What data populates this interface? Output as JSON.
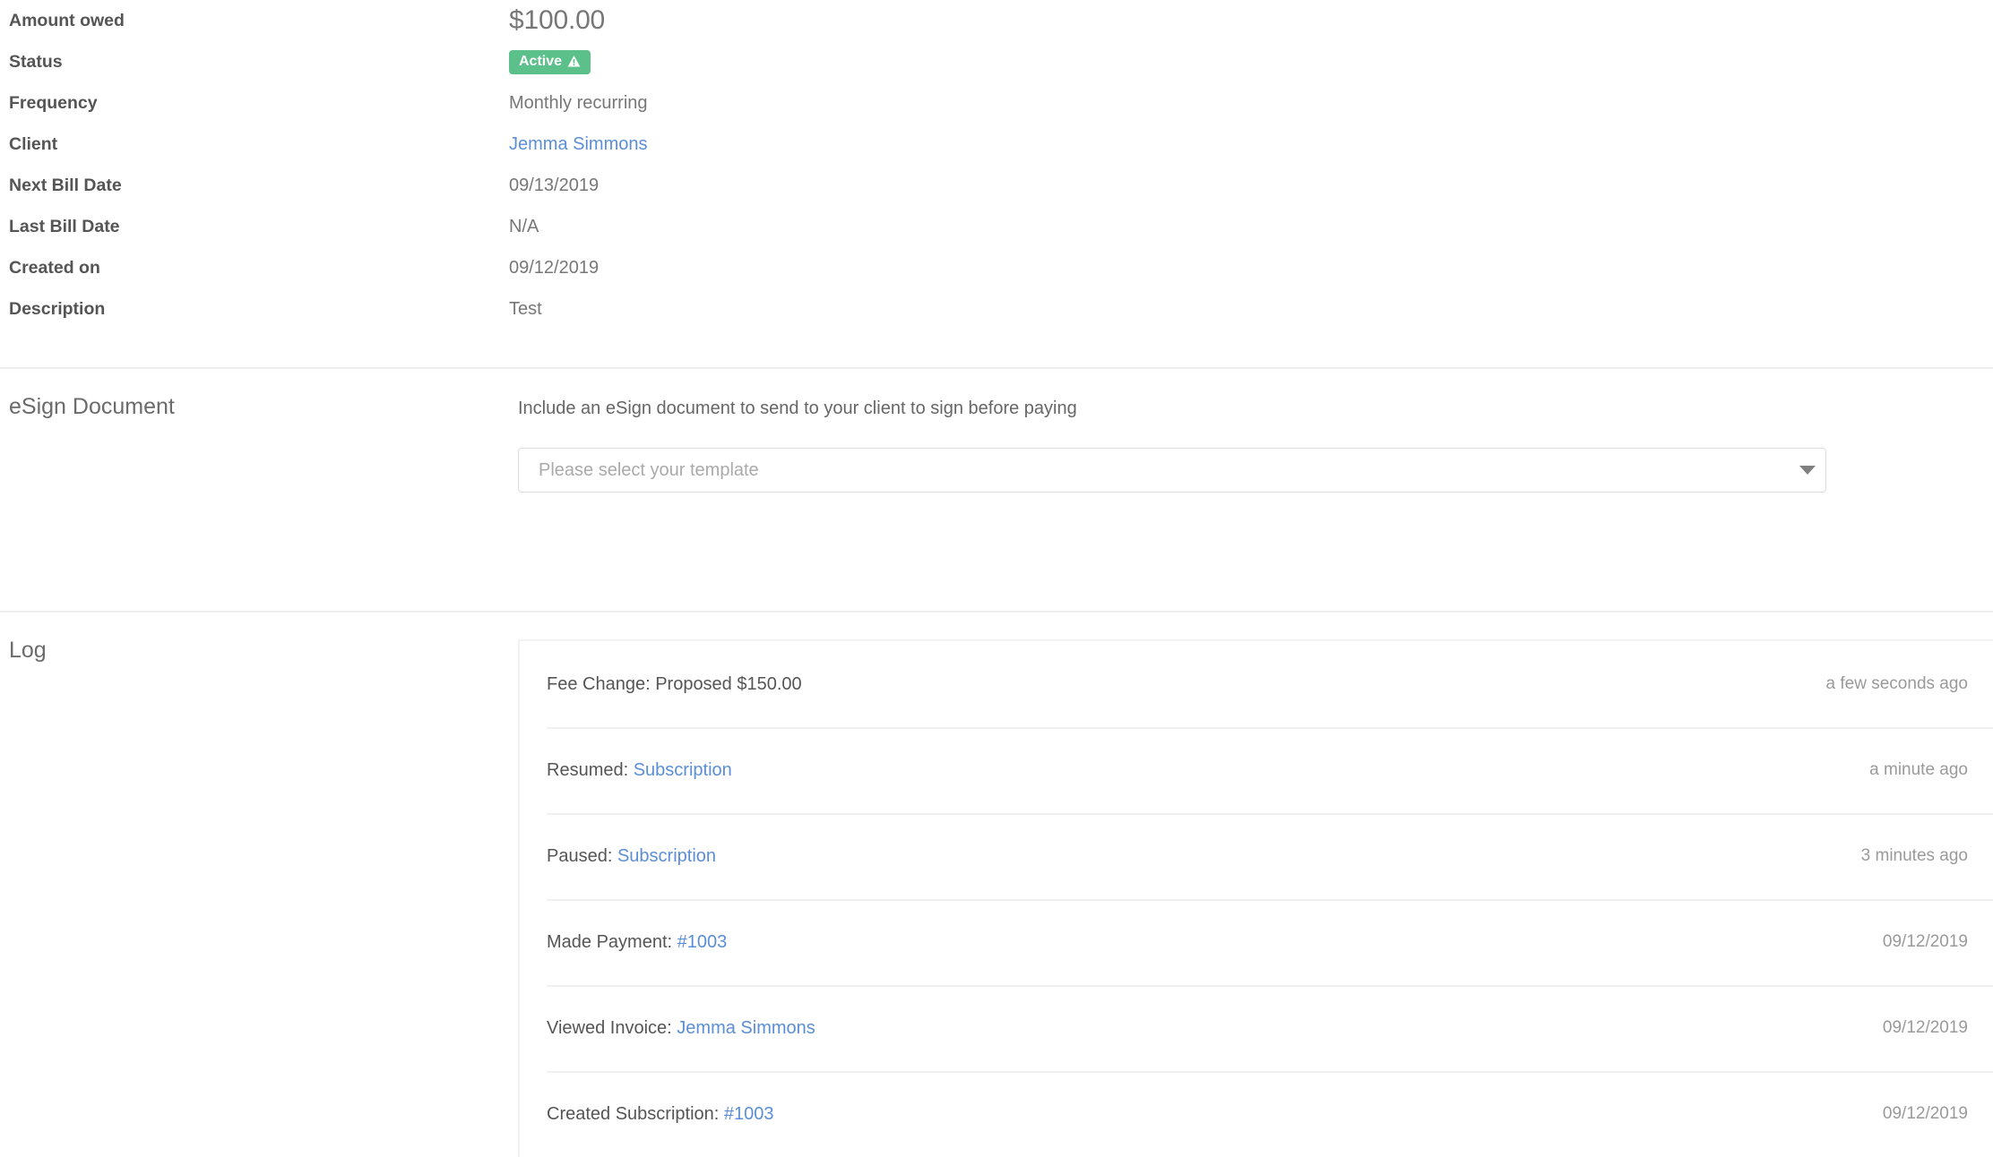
{
  "summary": {
    "fields": [
      {
        "label": "Amount owed",
        "value": "$100.00",
        "kind": "amount"
      },
      {
        "label": "Status",
        "value": "Active",
        "kind": "badge",
        "badge_icon": "warning-triangle-icon",
        "badge_color": "#5cc08a"
      },
      {
        "label": "Frequency",
        "value": "Monthly recurring",
        "kind": "text"
      },
      {
        "label": "Client",
        "value": "Jemma Simmons",
        "kind": "link"
      },
      {
        "label": "Next Bill Date",
        "value": "09/13/2019",
        "kind": "text"
      },
      {
        "label": "Last Bill Date",
        "value": "N/A",
        "kind": "text"
      },
      {
        "label": "Created on",
        "value": "09/12/2019",
        "kind": "text"
      },
      {
        "label": "Description",
        "value": "Test",
        "kind": "text"
      }
    ]
  },
  "esign": {
    "title": "eSign Document",
    "description": "Include an eSign document to send to your client to sign before paying",
    "select": {
      "placeholder": "Please select your template",
      "value": "",
      "icon": "chevron-down-icon"
    }
  },
  "log": {
    "title": "Log",
    "entries": [
      {
        "prefix": "Fee Change: Proposed $150.00",
        "link": "",
        "time": "a few seconds ago"
      },
      {
        "prefix": "Resumed: ",
        "link": "Subscription",
        "time": "a minute ago"
      },
      {
        "prefix": "Paused: ",
        "link": "Subscription",
        "time": "3 minutes ago"
      },
      {
        "prefix": "Made Payment: ",
        "link": "#1003",
        "time": "09/12/2019"
      },
      {
        "prefix": "Viewed Invoice: ",
        "link": "Jemma Simmons",
        "time": "09/12/2019"
      },
      {
        "prefix": "Created Subscription: ",
        "link": "#1003",
        "time": "09/12/2019"
      }
    ]
  },
  "colors": {
    "link": "#5b8ed6",
    "label": "#555555",
    "value": "#777777",
    "muted": "#9a9a9a",
    "divider": "#eeeeee",
    "success": "#5cc08a"
  }
}
